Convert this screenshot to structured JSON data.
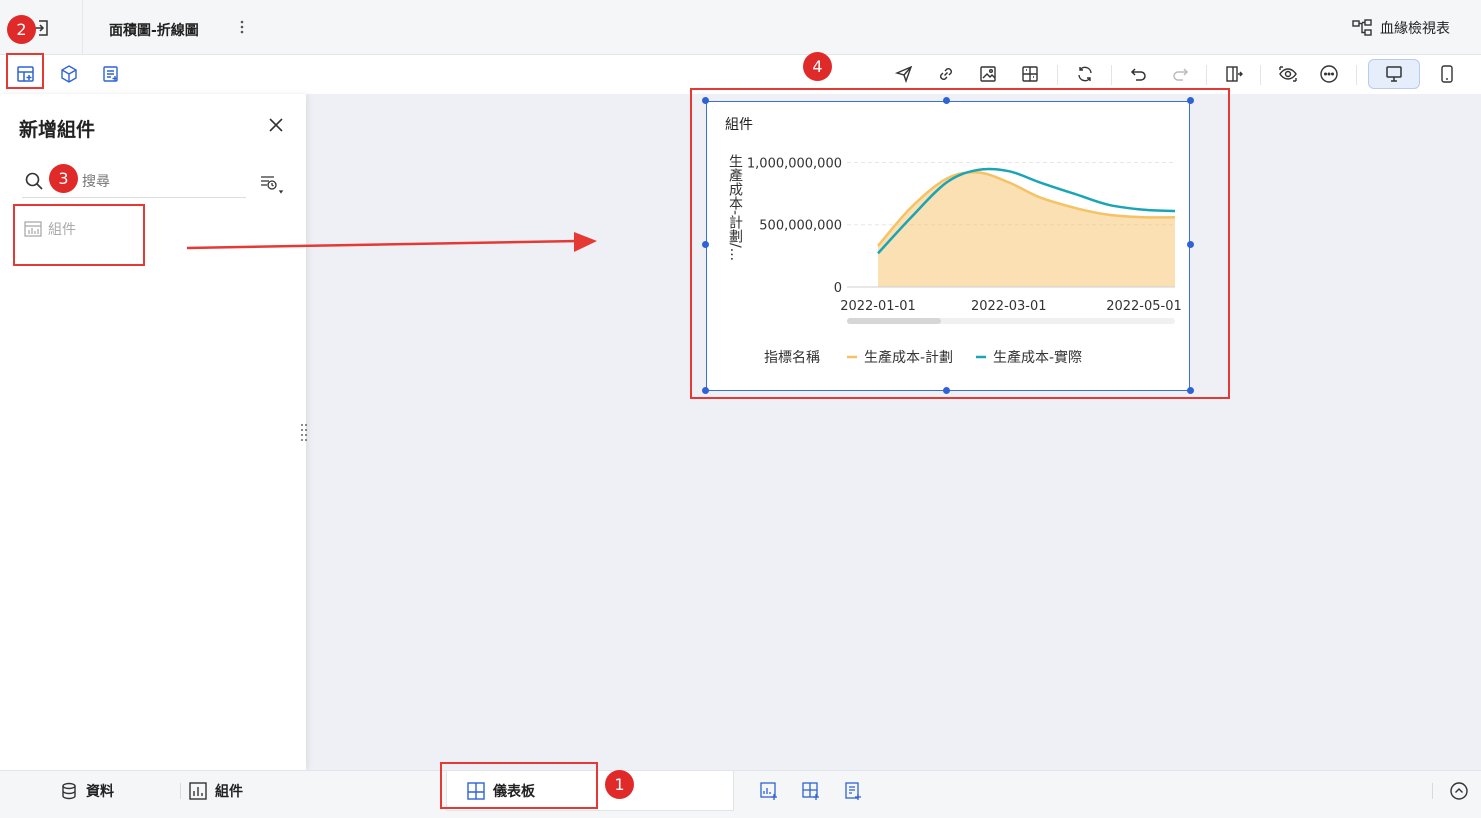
{
  "header": {
    "tab_title": "面積圖-折線圖",
    "lineage_label": "血緣檢視表"
  },
  "panel": {
    "title": "新增組件",
    "search_placeholder": "搜尋",
    "component_item_label": "組件"
  },
  "widget": {
    "title": "組件"
  },
  "chart_data": {
    "type": "area",
    "title": "組件",
    "ylabel": "生產成本-計劃/...",
    "ylim": [
      0,
      1100000000
    ],
    "y_ticks": [
      "1,000,000,000",
      "500,000,000",
      "0"
    ],
    "x_ticks": [
      "2022-01-01",
      "2022-03-01",
      "2022-05-01"
    ],
    "x": [
      "2022-01-01",
      "2022-01-16",
      "2022-02-01",
      "2022-02-15",
      "2022-03-01",
      "2022-03-15",
      "2022-04-01",
      "2022-04-15",
      "2022-05-01",
      "2022-05-15"
    ],
    "legend_title": "指標名稱",
    "series": [
      {
        "name": "生產成本-計劃",
        "render": "area",
        "color": "#f5c265",
        "values": [
          330000000,
          640000000,
          870000000,
          920000000,
          840000000,
          720000000,
          630000000,
          580000000,
          560000000,
          560000000
        ]
      },
      {
        "name": "生產成本-實際",
        "render": "line",
        "color": "#1aa5b5",
        "values": [
          270000000,
          560000000,
          840000000,
          940000000,
          930000000,
          840000000,
          740000000,
          660000000,
          620000000,
          610000000
        ]
      }
    ],
    "legend_position": "bottom"
  },
  "bottombar": {
    "data_label": "資料",
    "components_label": "組件",
    "dashboard_label": "儀表板"
  },
  "annotations": {
    "markers": [
      "1",
      "2",
      "3",
      "4"
    ]
  },
  "colors": {
    "accent": "#2f62d4",
    "annotation_red": "#e53935"
  }
}
